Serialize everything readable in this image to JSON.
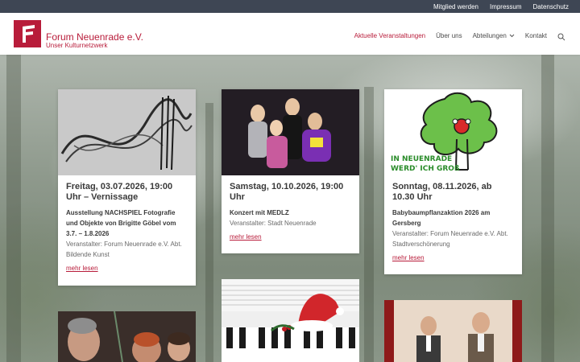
{
  "topbar": {
    "links": [
      "Mitglied werden",
      "Impressum",
      "Datenschutz"
    ]
  },
  "brand": {
    "title": "Forum Neuenrade e.V.",
    "subtitle": "Unser Kulturnetzwerk"
  },
  "nav": {
    "items": [
      "Aktuelle Veranstaltungen",
      "Über uns",
      "Abteilungen",
      "Kontakt"
    ]
  },
  "colors": {
    "accent": "#b81c3a",
    "topbar": "#3e4654"
  },
  "events": [
    {
      "date": "Freitag, 03.07.2026, 19:00 Uhr – Vernissage",
      "title": "Ausstellung NACHSPIEL Fotografie und Objekte von Brigitte Göbel vom 3.7. – 1.8.2026",
      "organizer": "Veranstalter: Forum Neuenrade e.V. Abt. Bildende Kunst",
      "more": "mehr lesen"
    },
    {
      "date": "Samstag, 10.10.2026, 19:00 Uhr",
      "title": "Konzert mit MEDLZ",
      "organizer": "Veranstalter: Stadt Neuenrade",
      "more": "mehr lesen"
    },
    {
      "date": "Sonntag, 08.11.2026, ab 10.30 Uhr",
      "title": "Babybaumpflanzaktion 2026 am Gersberg",
      "organizer": "Veranstalter: Forum Neuenrade e.V. Abt. Stadtverschönerung",
      "more": "mehr lesen"
    }
  ],
  "tree_logo_text": [
    "IN NEUENRADE",
    "WERD' ICH GROß"
  ]
}
